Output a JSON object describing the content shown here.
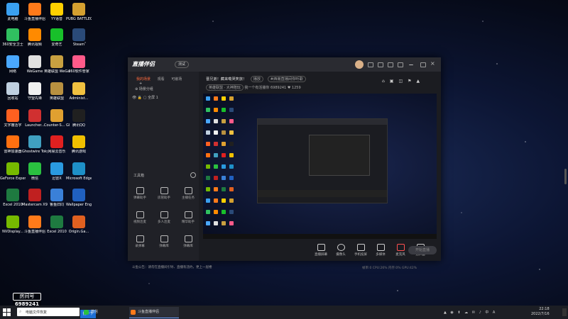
{
  "desktop": {
    "icons": [
      {
        "label": "此电脑",
        "color": "#3aa0f0"
      },
      {
        "label": "斗鱼直播伴侣",
        "color": "#ff7a1a"
      },
      {
        "label": "YY语音",
        "color": "#ffd000"
      },
      {
        "label": "PUBG BATTLEGR...",
        "color": "#d4a030"
      },
      {
        "label": "360安全卫士",
        "color": "#30c060"
      },
      {
        "label": "腾讯视频",
        "color": "#ff8a00"
      },
      {
        "label": "爱奇艺",
        "color": "#18c02a"
      },
      {
        "label": "Steam",
        "color": "#2a4a78"
      },
      {
        "label": "网络",
        "color": "#4aa8ff"
      },
      {
        "label": "WeGame",
        "color": "#e0e0e0"
      },
      {
        "label": "英雄联盟 WeGame版",
        "color": "#c8a040"
      },
      {
        "label": "360软件管家",
        "color": "#ff5a8a"
      },
      {
        "label": "回收站",
        "color": "#c0d0e0"
      },
      {
        "label": "守望先锋",
        "color": "#f0f0f0"
      },
      {
        "label": "英雄联盟",
        "color": "#b89040"
      },
      {
        "label": "Administ...",
        "color": "#f0c040"
      },
      {
        "label": "文字撤活字",
        "color": "#ff6020"
      },
      {
        "label": "Launcher...",
        "color": "#d03030"
      },
      {
        "label": "Counter-S... Global Off...",
        "color": "#e0a030"
      },
      {
        "label": "腾讯QQ",
        "color": "#202020"
      },
      {
        "label": "雷神加速器",
        "color": "#ff7010"
      },
      {
        "label": "Ghostwire Tokyo",
        "color": "#40a0c0"
      },
      {
        "label": "网易云音乐",
        "color": "#e02020"
      },
      {
        "label": "腾讯游戏",
        "color": "#f0c000"
      },
      {
        "label": "GeForce Experience",
        "color": "#76b900"
      },
      {
        "label": "微信",
        "color": "#2ac040"
      },
      {
        "label": "迅雷X",
        "color": "#2a9ae0"
      },
      {
        "label": "Microsoft Edge",
        "color": "#1e90c8"
      },
      {
        "label": "Excel 2010",
        "color": "#1e7a40"
      },
      {
        "label": "Mastercam X9",
        "color": "#c02020"
      },
      {
        "label": "鲁鱼旧同",
        "color": "#3a80d8"
      },
      {
        "label": "Wallpaper Engine:...",
        "color": "#2060c0"
      },
      {
        "label": "NVDisplay...",
        "color": "#76b900"
      },
      {
        "label": "斗鱼直播伴侣",
        "color": "#ff7a1a"
      },
      {
        "label": "Excel 2010",
        "color": "#1e7a40"
      },
      {
        "label": "Origin.Ga...",
        "color": "#e06020"
      }
    ]
  },
  "app": {
    "logo": "直播伴侣",
    "version": "测试",
    "tabs": [
      "我的场景",
      "观看",
      "可嵌场"
    ],
    "scene_search": "场景分组",
    "scene_item": "全屏 1",
    "tools_title": "工具箱",
    "tools": [
      "弹幕助手",
      "房管助手",
      "主播任务",
      "视频连麦",
      "多人连麦",
      "精华助手",
      "录弹幕",
      "弹幕库",
      "弹幕库"
    ],
    "notice": "斗鱼公告：请勿在直播间引导、直播有违约，更上一层楼",
    "room_title": "晋兄弟！藏来嘞哭笑旅！",
    "room_tag1": "播放",
    "room_tag2": "#西南直播间你听歌",
    "room_category": "英雄联盟 · 大神陪玩",
    "room_tag3": "英雄联盟",
    "room_info": "我一个有活播你 6989241",
    "room_fans": "1259",
    "controls": [
      "直播屏幕",
      "摄像头",
      "手机投屏",
      "多媒体",
      "麦克风",
      "扬声器"
    ],
    "start_button": "开始直播",
    "stats": "帧率:0  CPU:26%  内存:0%  GPU:42%"
  },
  "overlay": {
    "room_label": "房间号",
    "room_id": "6989241"
  },
  "taskbar": {
    "search_placeholder": "电脑文件恢复",
    "search_button": "搜一下",
    "tasks": [
      {
        "label": "微信",
        "color": "#2ac040",
        "active": false
      },
      {
        "label": "斗鱼直播伴侣",
        "color": "#ff7a1a",
        "active": true
      }
    ],
    "tray": "▲ ◉ ⬆ ☁ ✉ ♪ 中 A",
    "time": "22:18",
    "date": "2022/7/16"
  }
}
